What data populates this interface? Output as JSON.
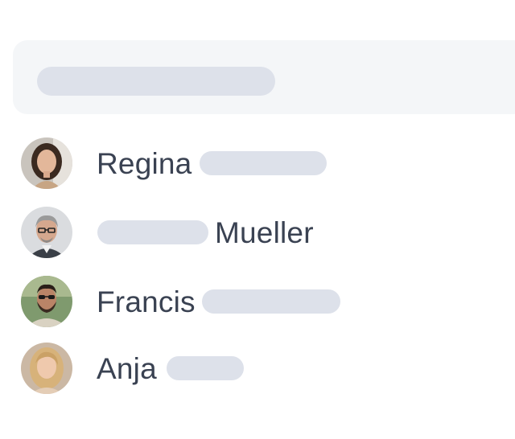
{
  "search": {
    "placeholder_visible": false
  },
  "people": [
    {
      "first_name": "Regina",
      "last_name": "",
      "avatar": "avatar-woman-brown-hair"
    },
    {
      "first_name": "",
      "last_name": "Mueller",
      "avatar": "avatar-man-gray-hair-glasses"
    },
    {
      "first_name": "Francis",
      "last_name": "",
      "avatar": "avatar-man-beard-sunglasses"
    },
    {
      "first_name": "Anja",
      "last_name": "",
      "avatar": "avatar-woman-blonde"
    }
  ],
  "colors": {
    "text": "#3a4252",
    "placeholder": "#dde1ea",
    "search_bg": "#f4f6f8"
  }
}
